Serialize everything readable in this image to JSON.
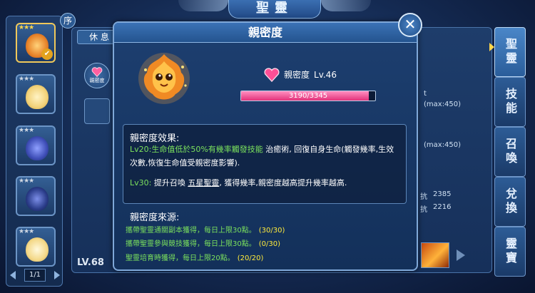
{
  "top": {
    "title": "聖靈",
    "sort_label": "序"
  },
  "pet_list": {
    "slots": [
      {
        "stars": "★★★",
        "selected": true,
        "color": "#e8842a"
      },
      {
        "stars": "★★★",
        "selected": false,
        "color": "#f2d27a"
      },
      {
        "stars": "★★★",
        "selected": false,
        "color": "#3f4fb8"
      },
      {
        "stars": "★★★",
        "selected": false,
        "color": "#2b3d8a"
      },
      {
        "stars": "★★★",
        "selected": false,
        "color": "#f4d98a"
      }
    ],
    "page": "1/1"
  },
  "detail": {
    "tab_rest": "休 息",
    "heart_button_label": "親密度",
    "level": "LV.68",
    "right_texts": [
      "(max:450)",
      "(max:450)",
      "抗",
      "2385",
      "抗",
      "2216"
    ]
  },
  "side_tabs": [
    "聖靈",
    "技能",
    "召喚",
    "兌換",
    "靈寶"
  ],
  "modal": {
    "title": "親密度",
    "intimacy_label": "親密度",
    "intimacy_level": "Lv.46",
    "progress_text": "3190/3345",
    "progress_fraction": 0.9537,
    "effects_title": "親密度效果:",
    "effects": [
      {
        "lv": "Lv20:",
        "text_a": "生命值低於50%有幾率觸發技能 ",
        "skill": "治癒術",
        "text_b": ", 回復自身生命(觸發幾率,生效次數,恢復生命值受親密度影響)."
      },
      {
        "lv": "Lv30:",
        "text_a": " 提升召喚 ",
        "skill": "五星聖靈",
        "text_b": ", 獲得幾率,親密度越高提升幾率越高."
      }
    ],
    "sources_title": "親密度來源:",
    "sources": [
      {
        "text": "攜帶聖靈通關副本獲得，每日上限30點。",
        "progress": "(30/30)"
      },
      {
        "text": "攜帶聖靈參與競技獲得，每日上限30點。",
        "progress": "(0/30)"
      },
      {
        "text": "聖靈培育時獲得，每日上限20點。",
        "progress": "(20/20)"
      }
    ]
  },
  "colors": {
    "accent_pink": "#e2327a",
    "text_green": "#7be15d",
    "highlight_yellow": "#ffeb3b"
  }
}
